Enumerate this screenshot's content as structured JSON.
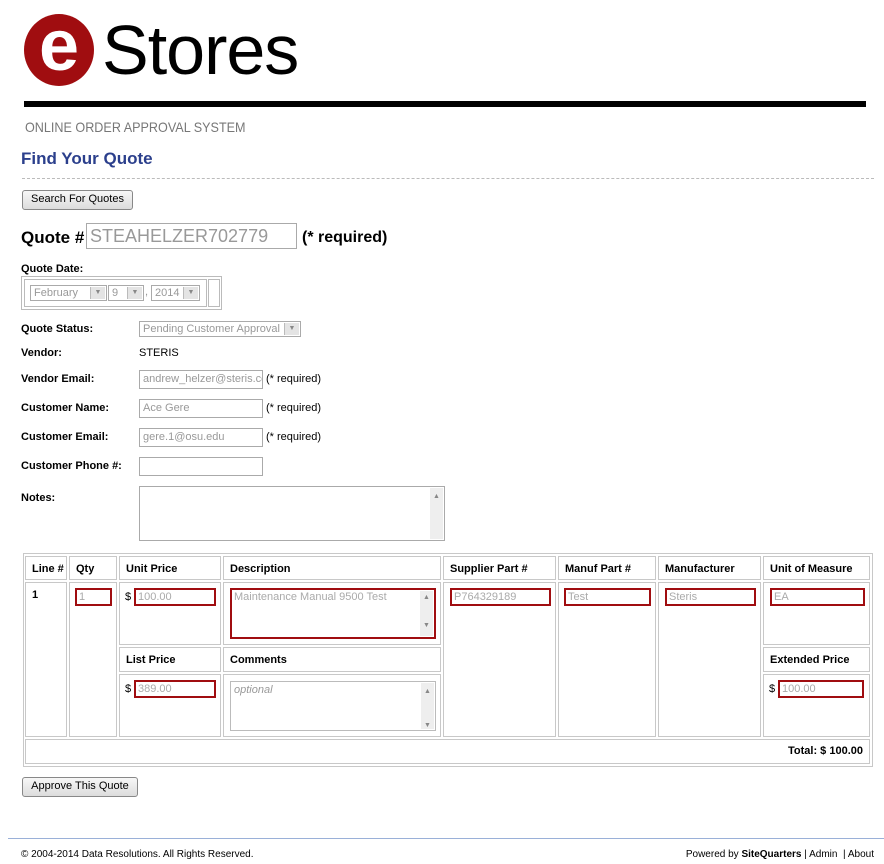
{
  "logo": {
    "mark": "e",
    "text": "Stores",
    "brand_color": "#a00d10"
  },
  "subtitle": "ONLINE ORDER APPROVAL SYSTEM",
  "page_title": "Find Your Quote",
  "search_button": "Search For Quotes",
  "quote": {
    "label": "Quote #",
    "value": "STEAHELZER702779",
    "required": "(* required)"
  },
  "quote_date": {
    "label": "Quote Date:",
    "month": "February",
    "day": "9",
    "sep": ",",
    "year": "2014"
  },
  "fields": {
    "status": {
      "label": "Quote Status:",
      "value": "Pending Customer Approval"
    },
    "vendor": {
      "label": "Vendor:",
      "value": "STERIS"
    },
    "vendor_email": {
      "label": "Vendor Email:",
      "value": "andrew_helzer@steris.com",
      "required": "(* required)"
    },
    "customer_name": {
      "label": "Customer Name:",
      "value": "Ace Gere",
      "required": "(* required)"
    },
    "customer_email": {
      "label": "Customer Email:",
      "value": "gere.1@osu.edu",
      "required": "(* required)"
    },
    "customer_phone": {
      "label": "Customer Phone #:",
      "value": ""
    },
    "notes": {
      "label": "Notes:",
      "value": ""
    }
  },
  "table": {
    "headers": [
      "Line #",
      "Qty",
      "Unit Price",
      "Description",
      "Supplier Part #",
      "Manuf Part #",
      "Manufacturer",
      "Unit of Measure"
    ],
    "list_price_header": "List Price",
    "comments_header": "Comments",
    "extended_price_header": "Extended Price",
    "currency": "$",
    "row": {
      "line": "1",
      "qty": "1",
      "unit_price": "100.00",
      "description": "Maintenance Manual 9500 Test",
      "supplier_part": "P764329189",
      "manuf_part": "Test",
      "manufacturer": "Steris",
      "uom": "EA",
      "list_price": "389.00",
      "comments_placeholder": "optional",
      "extended_price": "100.00"
    },
    "total": "Total: $ 100.00"
  },
  "approve_button": "Approve This Quote",
  "footer": {
    "copyright": "© 2004-2014 Data Resolutions. All Rights Reserved.",
    "powered": "Powered by",
    "brand": "SiteQuarters",
    "sep": "|",
    "admin": "Admin",
    "about": "About"
  }
}
